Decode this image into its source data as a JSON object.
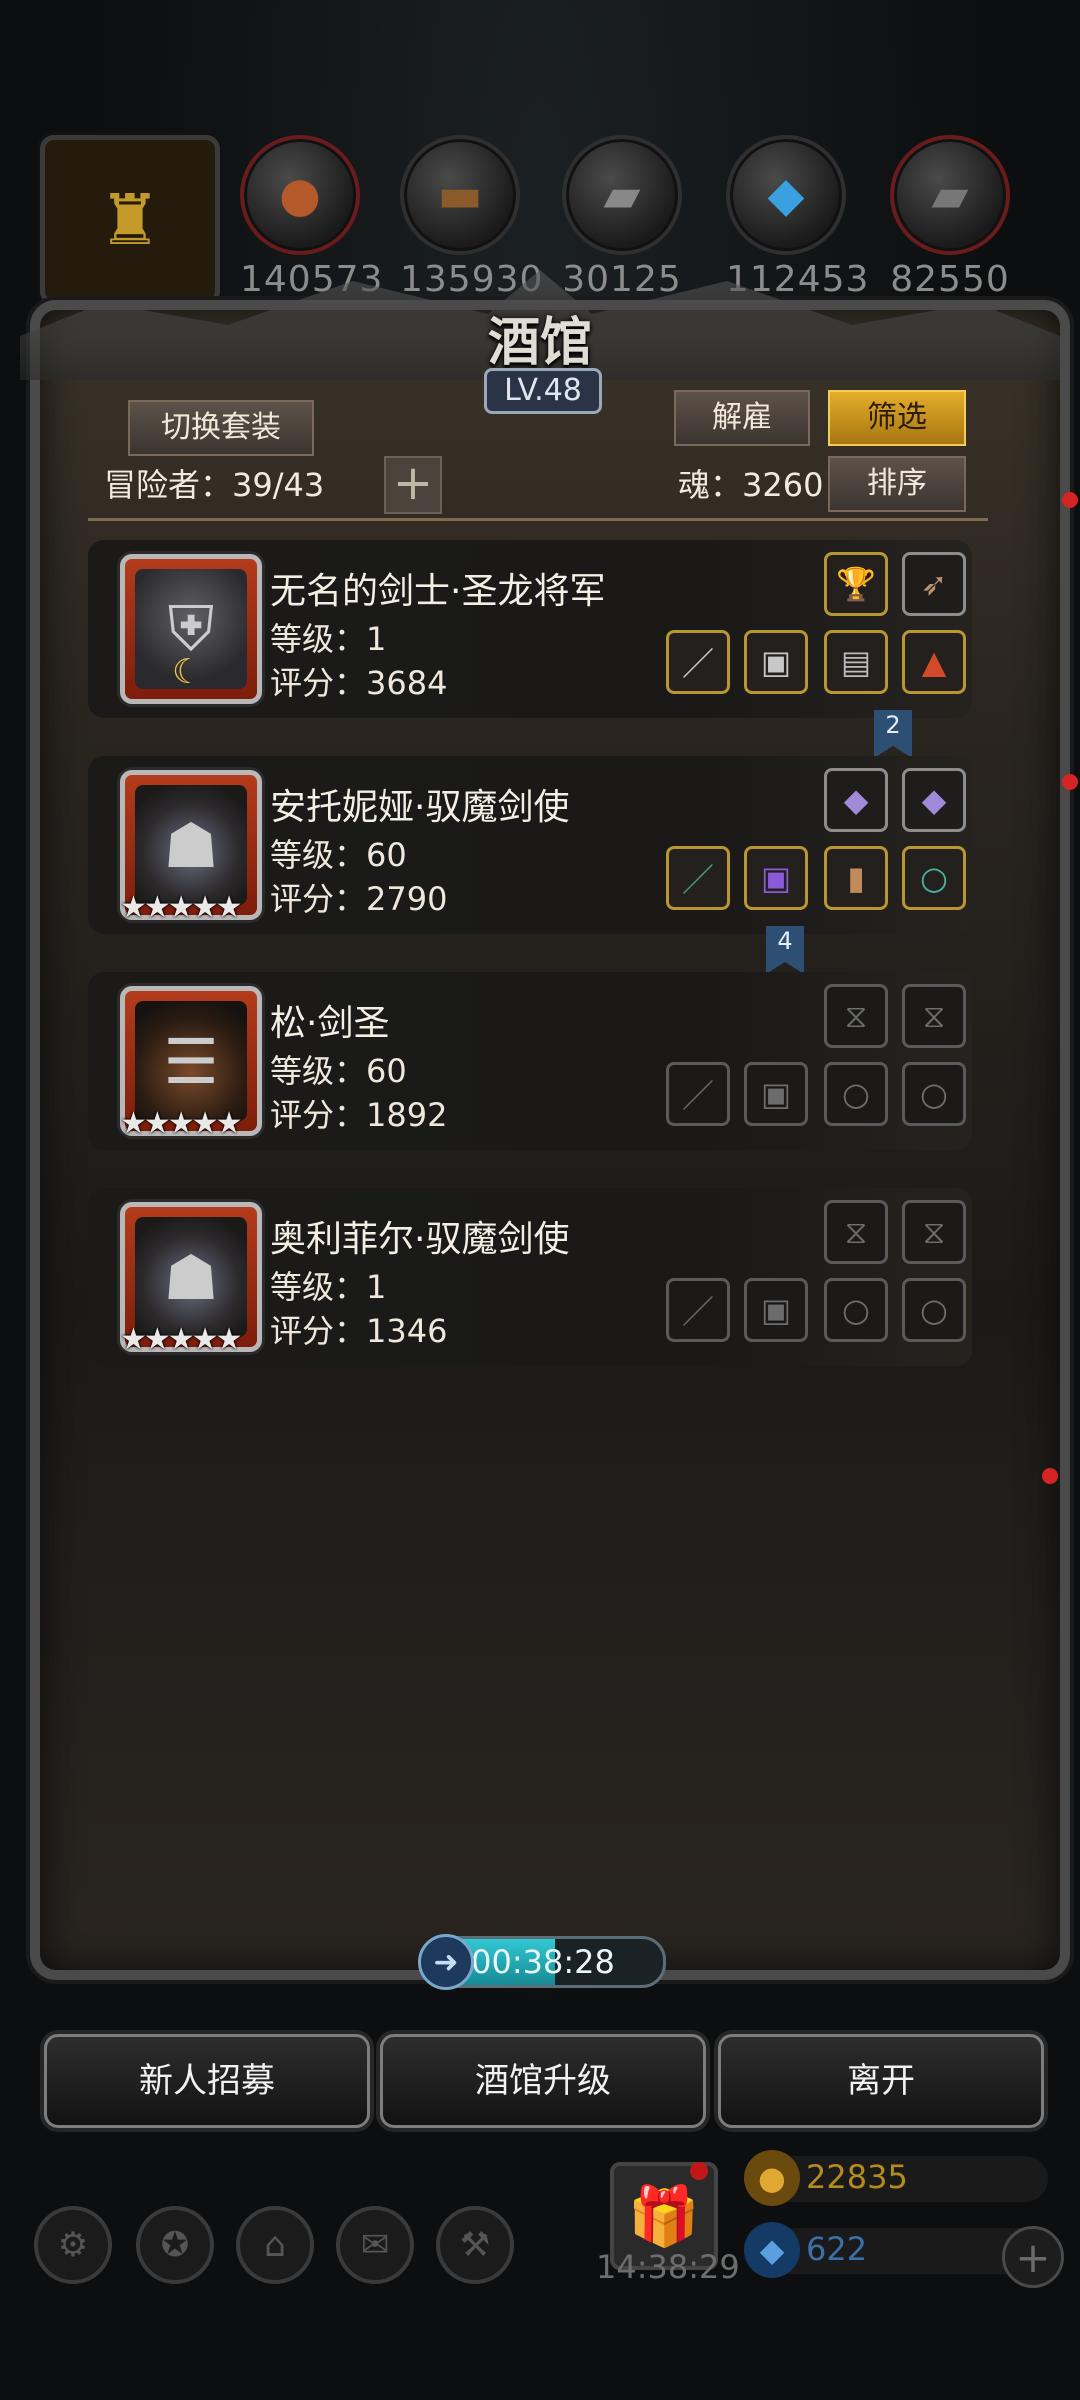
{
  "resources": [
    {
      "icon": "hero-portrait",
      "value": ""
    },
    {
      "icon": "meat-icon",
      "value": "140573"
    },
    {
      "icon": "wood-icon",
      "value": "135930"
    },
    {
      "icon": "iron-icon",
      "value": "30125"
    },
    {
      "icon": "crystal-icon",
      "value": "112453"
    },
    {
      "icon": "stone-icon",
      "value": "82550"
    }
  ],
  "tavern": {
    "title": "酒馆",
    "level": "LV.48"
  },
  "toolbar": {
    "switch_outfit": "切换套装",
    "dismiss": "解雇",
    "filter": "筛选",
    "sort": "排序",
    "adventurers_label": "冒险者：39/43",
    "soul_label": "魂：3260"
  },
  "heroes": [
    {
      "name": "无名的剑士·圣龙将军",
      "level": "等级：1",
      "score": "评分：3684",
      "stars": "",
      "tag": "2"
    },
    {
      "name": "安托妮娅·驭魔剑使",
      "level": "等级：60",
      "score": "评分：2790",
      "stars": "★★★★★",
      "tag": "4"
    },
    {
      "name": "松·剑圣",
      "level": "等级：60",
      "score": "评分：1892",
      "stars": "★★★★★",
      "tag": ""
    },
    {
      "name": "奥利菲尔·驭魔剑使",
      "level": "等级：1",
      "score": "评分：1346",
      "stars": "★★★★★",
      "tag": ""
    }
  ],
  "timer": {
    "value": "00:38:28",
    "fill": 0.55
  },
  "actions": {
    "recruit": "新人招募",
    "upgrade": "酒馆升级",
    "leave": "离开"
  },
  "hud": {
    "gift_time": "14:38:29",
    "gold": "22835",
    "gems": "622"
  },
  "colors": {
    "gold_accent": "#e4ae2a",
    "timer_fill": "#32c8d4",
    "gold_text": "#b38b1e",
    "gem_text": "#3a6fa8"
  }
}
